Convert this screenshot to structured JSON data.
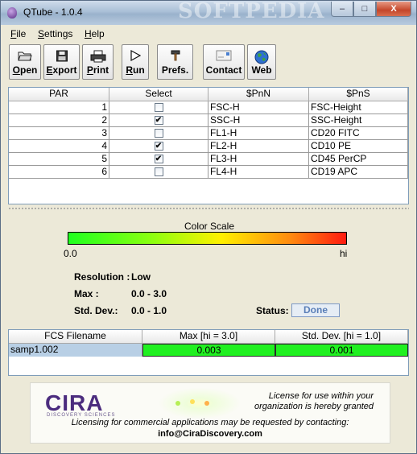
{
  "window": {
    "title": "QTube - 1.0.4",
    "watermark": "SOFTPEDIA"
  },
  "controls": {
    "minimize": "–",
    "maximize": "□",
    "close": "X"
  },
  "menu": [
    {
      "label_u": "F",
      "label_rest": "ile"
    },
    {
      "label_u": "S",
      "label_rest": "ettings"
    },
    {
      "label_u": "H",
      "label_rest": "elp"
    }
  ],
  "toolbar": {
    "open": {
      "u": "O",
      "rest": "pen",
      "icon": "folder-icon"
    },
    "export": {
      "u": "E",
      "rest": "xport",
      "icon": "floppy-disk-icon"
    },
    "print": {
      "u": "P",
      "rest": "rint",
      "icon": "printer-icon"
    },
    "run": {
      "u": "R",
      "rest": "un",
      "icon": "play-icon"
    },
    "prefs": {
      "label": "Prefs.",
      "icon": "hammer-icon"
    },
    "contact": {
      "label": "Contact",
      "icon": "envelope-icon"
    },
    "web": {
      "label": "Web",
      "icon": "globe-icon"
    }
  },
  "par_table": {
    "headers": [
      "PAR",
      "Select",
      "$PnN",
      "$PnS"
    ],
    "rows": [
      {
        "par": "1",
        "checked": false,
        "pnn": "FSC-H",
        "pns": "FSC-Height"
      },
      {
        "par": "2",
        "checked": true,
        "pnn": "SSC-H",
        "pns": "SSC-Height"
      },
      {
        "par": "3",
        "checked": false,
        "pnn": "FL1-H",
        "pns": "CD20 FITC"
      },
      {
        "par": "4",
        "checked": true,
        "pnn": "FL2-H",
        "pns": "CD10 PE"
      },
      {
        "par": "5",
        "checked": true,
        "pnn": "FL3-H",
        "pns": "CD45 PerCP"
      },
      {
        "par": "6",
        "checked": false,
        "pnn": "FL4-H",
        "pns": "CD19 APC"
      }
    ]
  },
  "color_scale": {
    "title": "Color Scale",
    "low": "0.0",
    "high": "hi"
  },
  "stats": {
    "resolution_label": "Resolution :",
    "resolution_value": "Low",
    "max_label": "Max :",
    "max_value": "0.0 - 3.0",
    "stddev_label": "Std. Dev.:",
    "stddev_value": "0.0 - 1.0",
    "status_label": "Status:",
    "status_value": "Done"
  },
  "fcs_table": {
    "headers": [
      "FCS Filename",
      "Max [hi = 3.0]",
      "Std. Dev. [hi = 1.0]"
    ],
    "rows": [
      {
        "filename": "samp1.002",
        "max": "0.003",
        "stddev": "0.001"
      }
    ],
    "cell_color": "#20f020"
  },
  "footer": {
    "logo_text": "CIRA",
    "logo_sub": "DISCOVERY SCIENCES",
    "license_line1": "License for use within your",
    "license_line2": "organization is hereby granted",
    "license_line3": "Licensing for commercial applications may be requested by contacting:",
    "email": "info@CiraDiscovery.com"
  }
}
